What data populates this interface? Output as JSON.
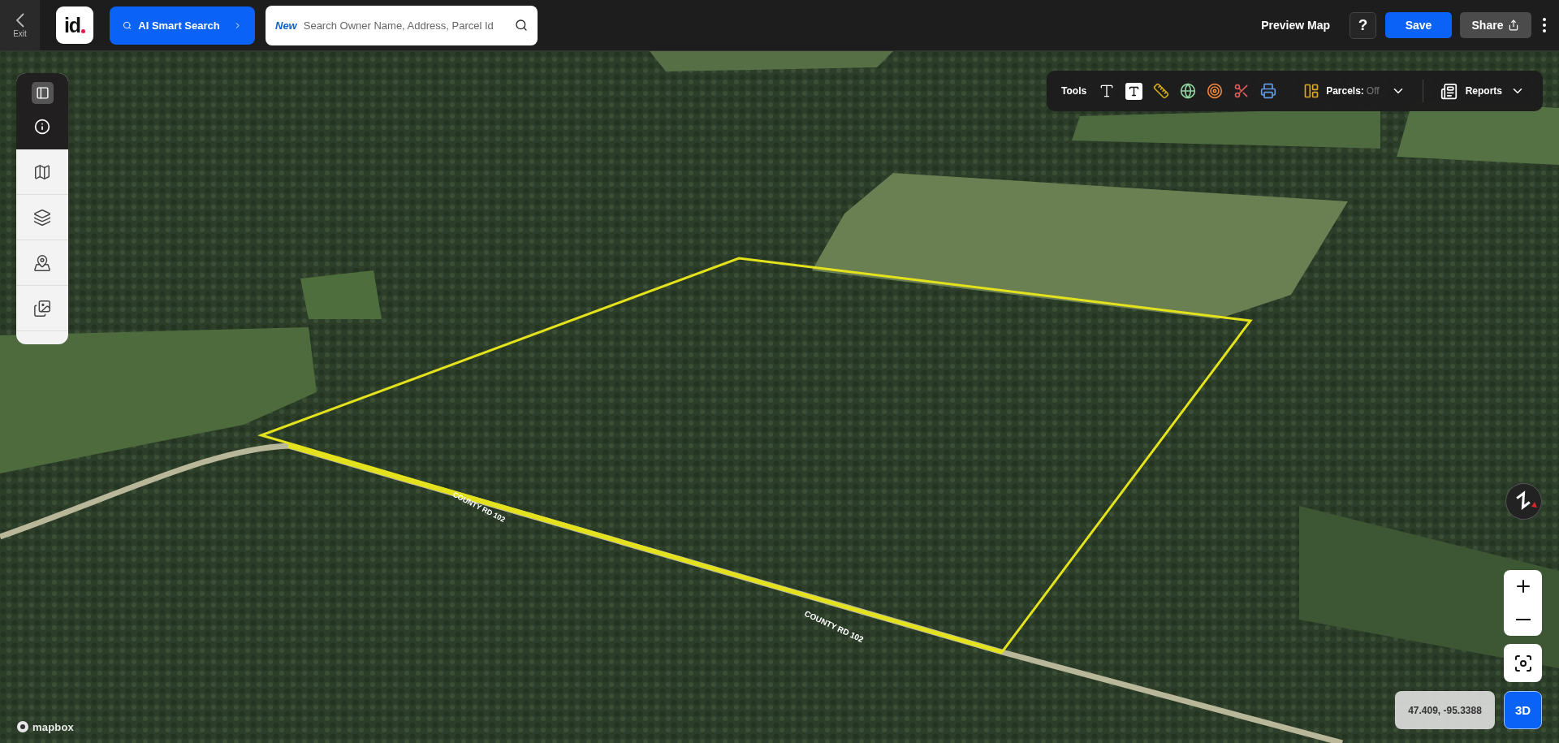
{
  "top_bar": {
    "exit_label": "Exit",
    "logo": "id",
    "ai_search": {
      "label": "AI Smart Search"
    },
    "search": {
      "badge": "New",
      "placeholder": "Search Owner Name, Address, Parcel Id"
    },
    "preview_map": "Preview Map",
    "help": "?",
    "save": "Save",
    "share": "Share"
  },
  "toolbar": {
    "label": "Tools",
    "parcels": {
      "label": "Parcels:",
      "value": "Off"
    },
    "reports": "Reports"
  },
  "map": {
    "road_labels": [
      "COUNTY RD 102",
      "COUNTY RD 102"
    ],
    "coordinates": "47.409, -95.3388",
    "mode_button": "3D",
    "attribution": "mapbox"
  }
}
